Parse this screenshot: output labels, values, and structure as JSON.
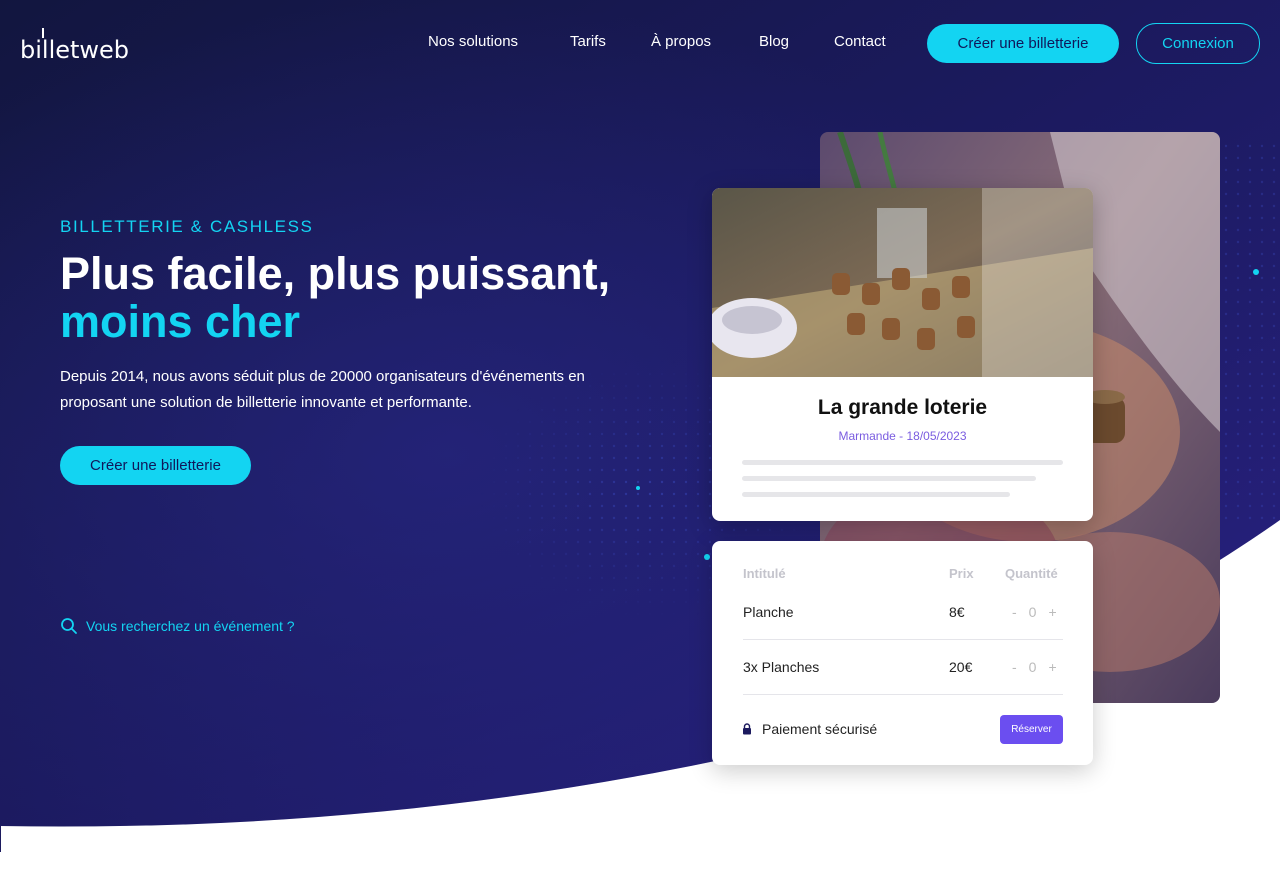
{
  "colors": {
    "accent": "#13d4f2",
    "navy": "#1c1a5e",
    "purple": "#6b4ef0"
  },
  "brand": {
    "logo_text": "billetweb"
  },
  "nav": {
    "links": [
      "Nos solutions",
      "Tarifs",
      "À propos",
      "Blog",
      "Contact"
    ],
    "cta_label": "Créer une billetterie",
    "login_label": "Connexion"
  },
  "hero": {
    "kicker": "BILLETTERIE & CASHLESS",
    "headline_line1": "Plus facile, plus puissant,",
    "headline_line2": "moins cher",
    "description": "Depuis 2014, nous avons séduit plus de 20000 organisateurs d'événements en proposant une solution de billetterie innovante et performante.",
    "button_label": "Créer une billetterie",
    "search_link": "Vous recherchez un événement ?",
    "search_icon": "search-icon"
  },
  "event_card": {
    "title": "La grande loterie",
    "subtitle": "Marmande - 18/05/2023"
  },
  "ticket_card": {
    "headers": {
      "name": "Intitulé",
      "price": "Prix",
      "quantity": "Quantité"
    },
    "rows": [
      {
        "name": "Planche",
        "price": "8€",
        "qty": "0"
      },
      {
        "name": "3x Planches",
        "price": "20€",
        "qty": "0"
      }
    ],
    "minus": "-",
    "plus": "+",
    "secure_label": "Paiement sécurisé",
    "lock_icon": "lock-icon",
    "reserve_label": "Réserver"
  }
}
